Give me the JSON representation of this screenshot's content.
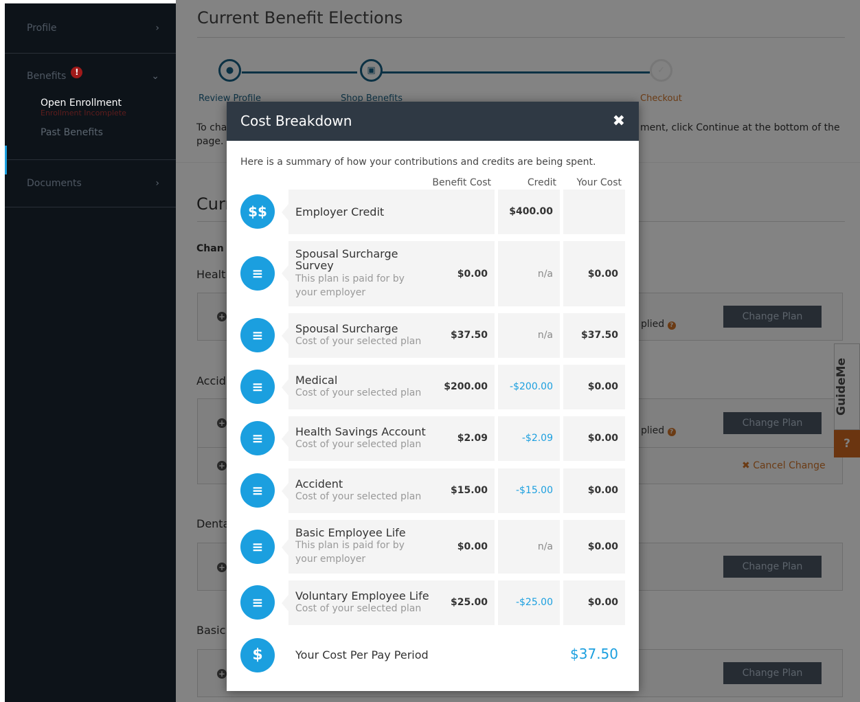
{
  "sidebar": {
    "profile": "Profile",
    "benefits": "Benefits",
    "alert_mark": "!",
    "open_enrollment": "Open Enrollment",
    "enrollment_status": "Enrollment Incomplete",
    "past_benefits": "Past Benefits",
    "documents": "Documents",
    "chevron_right": "›",
    "chevron_down": "⌄"
  },
  "page": {
    "title": "Current Benefit Elections",
    "steps": [
      "Review Profile",
      "Shop Benefits",
      "Checkout"
    ],
    "instruction_left": "To cha",
    "instruction_right": "ment, click Continue at the bottom of the",
    "instruction_page": "page.",
    "section_heading_partial": "Curr",
    "change_heading_partial": "Chan",
    "health_partial": "Healt",
    "accident_partial": "Accid",
    "dental_partial": "Denta",
    "basic_partial": "Basic",
    "applied_text": "plied",
    "change_plan": "Change Plan",
    "cancel_change": "Cancel Change"
  },
  "guideme": {
    "label": "GuideMe",
    "help": "?"
  },
  "modal": {
    "title": "Cost Breakdown",
    "close": "✖",
    "intro": "Here is a summary of how your contributions and credits are being spent.",
    "columns": [
      "Benefit Cost",
      "Credit",
      "Your Cost"
    ],
    "rows": [
      {
        "icon": "$$",
        "name": "Employer Credit",
        "sub": "",
        "cost": "",
        "credit": "$400.00",
        "your": ""
      },
      {
        "icon": "list",
        "name": "Spousal Surcharge Survey",
        "sub": "This plan is paid for by your employer",
        "cost": "$0.00",
        "credit": "n/a",
        "your": "$0.00"
      },
      {
        "icon": "list",
        "name": "Spousal Surcharge",
        "sub": "Cost of your selected plan",
        "cost": "$37.50",
        "credit": "n/a",
        "your": "$37.50"
      },
      {
        "icon": "list",
        "name": "Medical",
        "sub": "Cost of your selected plan",
        "cost": "$200.00",
        "credit": "-$200.00",
        "your": "$0.00"
      },
      {
        "icon": "list",
        "name": "Health Savings Account",
        "sub": "Cost of your selected plan",
        "cost": "$2.09",
        "credit": "-$2.09",
        "your": "$0.00"
      },
      {
        "icon": "list",
        "name": "Accident",
        "sub": "Cost of your selected plan",
        "cost": "$15.00",
        "credit": "-$15.00",
        "your": "$0.00"
      },
      {
        "icon": "list",
        "name": "Basic Employee Life",
        "sub": "This plan is paid for by your employer",
        "cost": "$0.00",
        "credit": "n/a",
        "your": "$0.00"
      },
      {
        "icon": "list",
        "name": "Voluntary Employee Life",
        "sub": "Cost of your selected plan",
        "cost": "$25.00",
        "credit": "-$25.00",
        "your": "$0.00"
      }
    ],
    "total_icon": "$",
    "total_label": "Your Cost Per Pay Period",
    "total_value": "$37.50"
  }
}
